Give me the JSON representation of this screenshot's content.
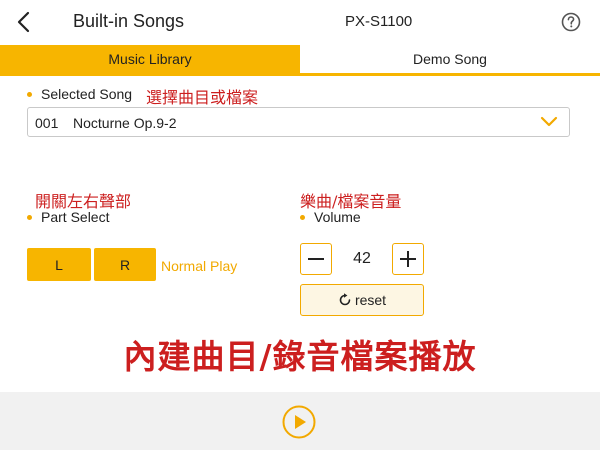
{
  "header": {
    "title": "Built-in Songs",
    "device": "PX-S1100",
    "back_icon": "chevron-left-icon",
    "help_icon": "help-circle-icon"
  },
  "tabs": [
    {
      "label": "Music Library",
      "active": true
    },
    {
      "label": "Demo Song",
      "active": false
    }
  ],
  "selected_song": {
    "label": "Selected Song",
    "annotation": "選擇曲目或檔案",
    "number": "001",
    "name": "Nocturne Op.9-2"
  },
  "part_select": {
    "annotation": "開關左右聲部",
    "label": "Part Select",
    "left_label": "L",
    "right_label": "R",
    "mode_text": "Normal Play"
  },
  "volume": {
    "annotation": "樂曲/檔案音量",
    "label": "Volume",
    "value": "42",
    "reset_label": "reset"
  },
  "big_annotation": "內建曲目/錄音檔案播放",
  "colors": {
    "accent": "#f7b500",
    "annotation": "#cc1f1f",
    "footer_bg": "#f1f1f1"
  }
}
